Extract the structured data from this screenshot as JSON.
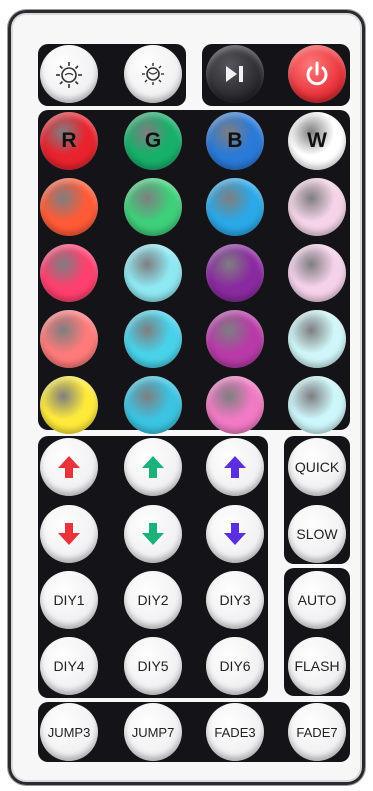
{
  "remote": {
    "top_row": [
      {
        "name": "brightness-up-icon"
      },
      {
        "name": "brightness-down-icon"
      },
      {
        "name": "play-pause-icon",
        "color": "#2b2b30"
      },
      {
        "name": "power-icon",
        "color": "#e8333a"
      }
    ],
    "color_buttons": [
      {
        "label": "R",
        "color": "#e8232e"
      },
      {
        "label": "G",
        "color": "#17b06a"
      },
      {
        "label": "B",
        "color": "#2a7ad8"
      },
      {
        "label": "W",
        "color": "#ffffff"
      },
      {
        "color": "#ff5a37"
      },
      {
        "color": "#3ecf7a"
      },
      {
        "color": "#2aa8e8"
      },
      {
        "color": "#f4d4e6"
      },
      {
        "color": "#ff3f6f"
      },
      {
        "color": "#8ee8f2"
      },
      {
        "color": "#8a2aa0"
      },
      {
        "color": "#f6d2ea"
      },
      {
        "color": "#ff7a7a"
      },
      {
        "color": "#48d2ea"
      },
      {
        "color": "#b83aa8"
      },
      {
        "color": "#cff6f8"
      },
      {
        "color": "#ffea3a"
      },
      {
        "color": "#3ac4e2"
      },
      {
        "color": "#f07ac4"
      },
      {
        "color": "#ccf6fa"
      }
    ],
    "arrows": [
      {
        "name": "red-up-arrow-icon",
        "color": "#e8333a",
        "dir": "up"
      },
      {
        "name": "green-up-arrow-icon",
        "color": "#1ab27a",
        "dir": "up"
      },
      {
        "name": "blue-up-arrow-icon",
        "color": "#5b2ee0",
        "dir": "up"
      },
      {
        "name": "red-down-arrow-icon",
        "color": "#e8333a",
        "dir": "down"
      },
      {
        "name": "green-down-arrow-icon",
        "color": "#1ab27a",
        "dir": "down"
      },
      {
        "name": "blue-down-arrow-icon",
        "color": "#5b2ee0",
        "dir": "down"
      }
    ],
    "labels": {
      "quick": "QUICK",
      "slow": "SLOW",
      "diy1": "DIY1",
      "diy2": "DIY2",
      "diy3": "DIY3",
      "diy4": "DIY4",
      "diy5": "DIY5",
      "diy6": "DIY6",
      "auto": "AUTO",
      "flash": "FLASH",
      "jump3": "JUMP3",
      "jump7": "JUMP7",
      "fade3": "FADE3",
      "fade7": "FADE7"
    }
  }
}
